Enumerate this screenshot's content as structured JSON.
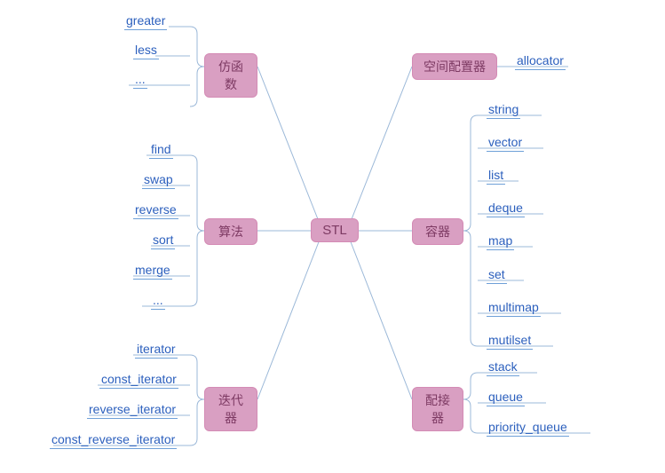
{
  "root": {
    "label": "STL"
  },
  "branches": {
    "functors": {
      "label": "仿函数",
      "leaves": [
        "greater",
        "less",
        "..."
      ]
    },
    "allocator": {
      "label": "空间配置器",
      "leaves": [
        "allocator"
      ]
    },
    "algorithm": {
      "label": "算法",
      "leaves": [
        "find",
        "swap",
        "reverse",
        "sort",
        "merge",
        "..."
      ]
    },
    "container": {
      "label": "容器",
      "leaves": [
        "string",
        "vector",
        "list",
        "deque",
        "map",
        "set",
        "multimap",
        "mutilset"
      ]
    },
    "iterator": {
      "label": "迭代器",
      "leaves": [
        "iterator",
        "const_iterator",
        "reverse_iterator",
        "const_reverse_iterator"
      ]
    },
    "adapter": {
      "label": "配接器",
      "leaves": [
        "stack",
        "queue",
        "priority_queue"
      ]
    }
  },
  "chart_data": {
    "type": "mindmap",
    "root": "STL",
    "children": [
      {
        "name": "仿函数",
        "children": [
          "greater",
          "less",
          "..."
        ]
      },
      {
        "name": "空间配置器",
        "children": [
          "allocator"
        ]
      },
      {
        "name": "算法",
        "children": [
          "find",
          "swap",
          "reverse",
          "sort",
          "merge",
          "..."
        ]
      },
      {
        "name": "容器",
        "children": [
          "string",
          "vector",
          "list",
          "deque",
          "map",
          "set",
          "multimap",
          "mutilset"
        ]
      },
      {
        "name": "迭代器",
        "children": [
          "iterator",
          "const_iterator",
          "reverse_iterator",
          "const_reverse_iterator"
        ]
      },
      {
        "name": "配接器",
        "children": [
          "stack",
          "queue",
          "priority_queue"
        ]
      }
    ]
  }
}
